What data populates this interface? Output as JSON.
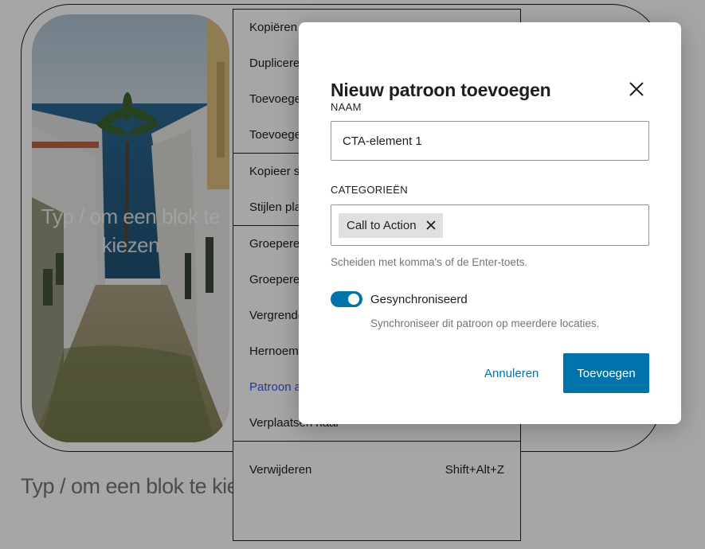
{
  "editor": {
    "image_placeholder": "Typ / om een blok te kiezen",
    "paragraph_placeholder": "Typ / om een blok te kiezen"
  },
  "block_menu": {
    "groups": [
      [
        {
          "label": "Kopiëren"
        },
        {
          "label": "Dupliceren"
        },
        {
          "label": "Toevoegen"
        },
        {
          "label": "Toevoegen"
        }
      ],
      [
        {
          "label": "Kopieer stijlen"
        },
        {
          "label": "Stijlen plakken"
        }
      ],
      [
        {
          "label": "Groeperen"
        },
        {
          "label": "Groeperen"
        },
        {
          "label": "Vergrendelen"
        },
        {
          "label": "Hernoemen"
        },
        {
          "label": "Patroon aanmaken"
        },
        {
          "label": "Verplaatsen naar"
        }
      ],
      [
        {
          "label": "Verwijderen",
          "shortcut": "Shift+Alt+Z"
        }
      ]
    ]
  },
  "modal": {
    "title": "Nieuw patroon toevoegen",
    "name_label": "NAAM",
    "name_value": "CTA-element 1",
    "categories_label": "CATEGORIEËN",
    "category_token": "Call to Action",
    "categories_help": "Scheiden met komma's of de Enter-toets.",
    "sync_label": "Gesynchroniseerd",
    "sync_help": "Synchroniseer dit patroon op meerdere locaties.",
    "sync_enabled": true,
    "cancel_label": "Annuleren",
    "submit_label": "Toevoegen"
  },
  "colors": {
    "primary": "#0073aa",
    "menu_highlight": "#3858e9",
    "text": "#1e1e1e",
    "muted": "#757575"
  }
}
